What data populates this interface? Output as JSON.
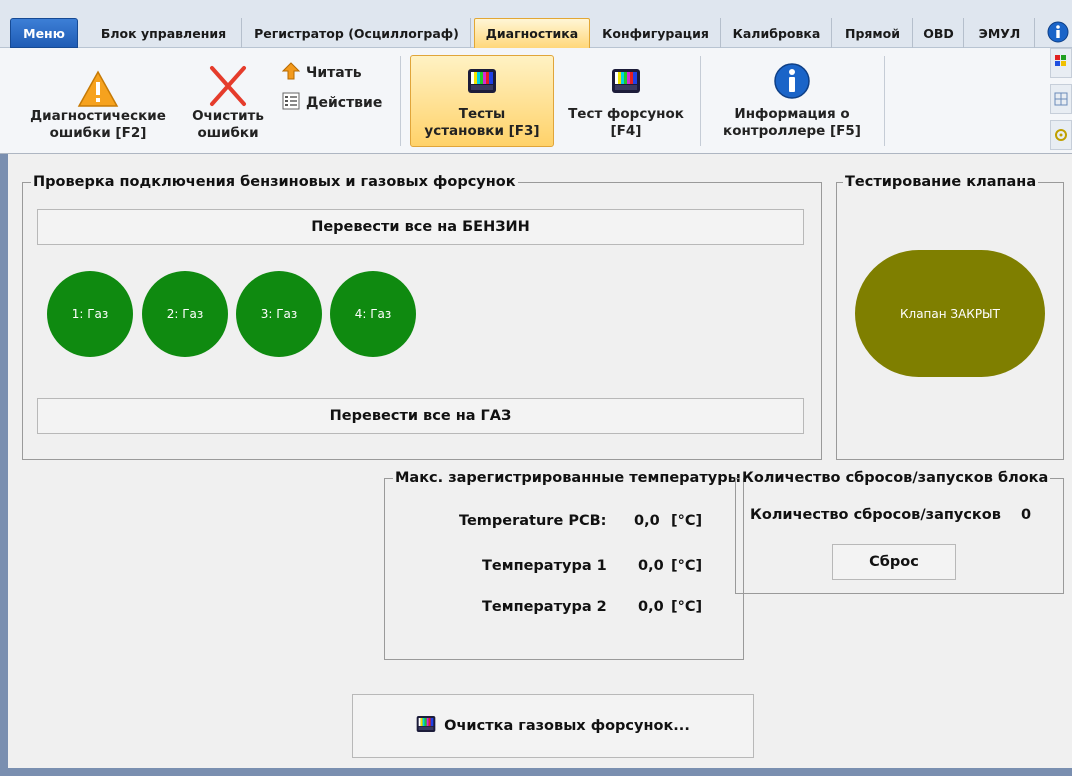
{
  "tabs": [
    {
      "id": "menu",
      "label": "Меню"
    },
    {
      "id": "block",
      "label": "Блок управления"
    },
    {
      "id": "recorder",
      "label": "Регистратор (Осциллограф)"
    },
    {
      "id": "diagnostics",
      "label": "Диагностика"
    },
    {
      "id": "config",
      "label": "Конфигурация"
    },
    {
      "id": "calibration",
      "label": "Калибровка"
    },
    {
      "id": "direct",
      "label": "Прямой"
    },
    {
      "id": "obd",
      "label": "OBD"
    },
    {
      "id": "emul",
      "label": "ЭМУЛ"
    }
  ],
  "ribbon": {
    "diag_errors": {
      "line1": "Диагностические",
      "line2": "ошибки [F2]"
    },
    "clear_errors": {
      "line1": "Очистить",
      "line2": "ошибки"
    },
    "read": "Читать",
    "action": "Действие",
    "install_tests": {
      "line1": "Тесты",
      "line2": "установки [F3]"
    },
    "injector_test": {
      "line1": "Тест форсунок",
      "line2": "[F4]"
    },
    "controller_info": {
      "line1": "Информация о",
      "line2": "контроллере [F5]"
    }
  },
  "injector_group": {
    "title": "Проверка подключения бензиновых и газовых форсунок",
    "to_petrol": "Перевести все на БЕНЗИН",
    "to_gas": "Перевести все на ГАЗ",
    "injectors": [
      "1: Газ",
      "2: Газ",
      "3: Газ",
      "4: Газ"
    ]
  },
  "valve_group": {
    "title": "Тестирование клапана",
    "state": "Клапан ЗАКРЫТ"
  },
  "temps": {
    "title": "Макс. зарегистрированные температуры",
    "rows": [
      {
        "label": "Temperature PCB:",
        "value": "0,0",
        "unit": "[°C]"
      },
      {
        "label": "Температура 1",
        "value": "0,0",
        "unit": "[°C]"
      },
      {
        "label": "Температура 2",
        "value": "0,0",
        "unit": "[°C]"
      }
    ]
  },
  "resets": {
    "title": "Количество сбросов/запусков блока",
    "label": "Количество сбросов/запусков",
    "count": "0",
    "reset_button": "Сброс"
  },
  "cleaning_button": "Очистка газовых форсунок...",
  "colors": {
    "injector_gas": "#0f8a10",
    "valve_closed": "#7f7f00",
    "accent_tab": "#ffd77a"
  }
}
